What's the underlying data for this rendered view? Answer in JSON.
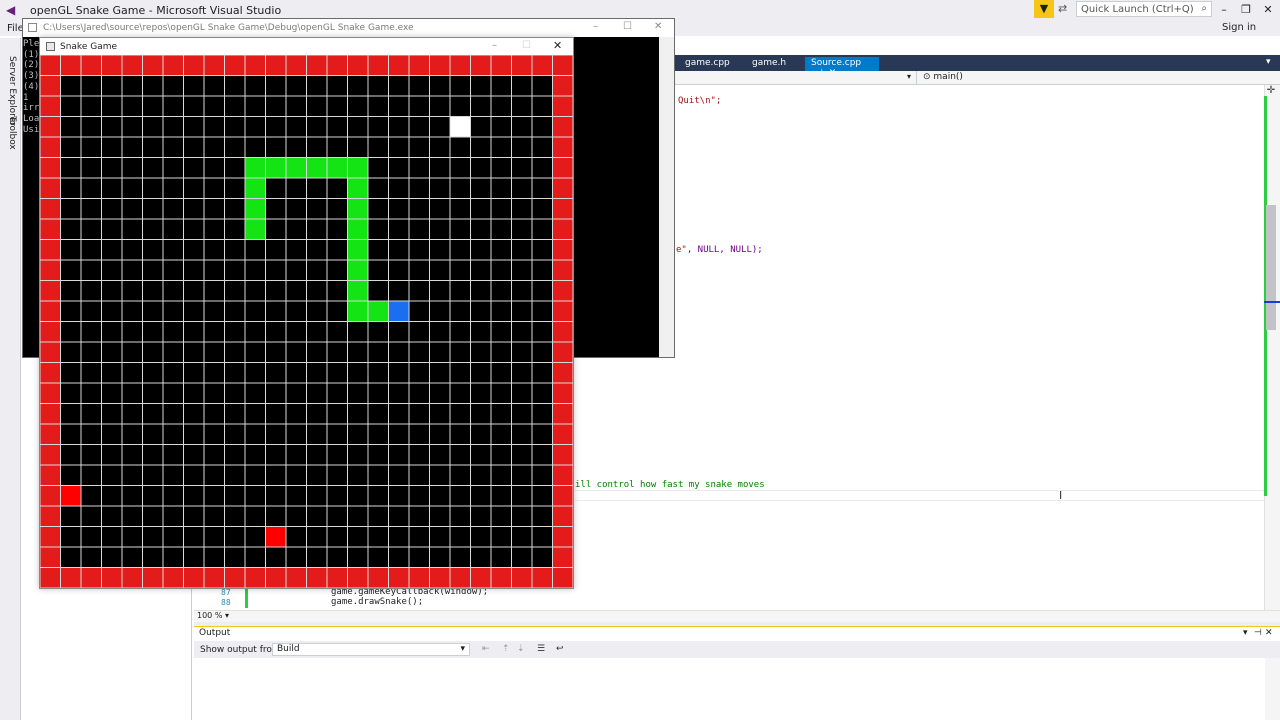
{
  "vs": {
    "title": "openGL Snake Game - Microsoft Visual Studio",
    "menu_file": "File",
    "quick_launch_placeholder": "Quick Launch (Ctrl+Q)",
    "sign_in": "Sign in",
    "side_tabs": [
      "Server Explorer",
      "Toolbox"
    ]
  },
  "console": {
    "title": "C:\\Users\\Jared\\source\\repos\\openGL Snake Game\\Debug\\openGL Snake Game.exe",
    "lines": [
      "Ple",
      "(1)",
      "(2)",
      "(3)",
      "(4)",
      "1",
      "irr",
      "Loa",
      "Usi"
    ]
  },
  "editor": {
    "tabs": [
      "game.cpp",
      "game.h",
      "Source.cpp"
    ],
    "active_tab": "Source.cpp",
    "scope": "main()",
    "code_fragment_1": "Quit\\n\";",
    "code_fragment_2_str": "e\"",
    "code_fragment_2_rest": ", NULL, NULL);",
    "comment_fragment": "ill control how fast my snake moves",
    "line_87": "87",
    "line_88": "88",
    "code_87": "game.gameKeyCallback(window);",
    "code_88": "game.drawSnake();",
    "zoom": "100 %"
  },
  "output": {
    "title": "Output",
    "show_from_label": "Show output from:",
    "show_from_value": "Build"
  },
  "snake_window": {
    "title": "Snake Game",
    "grid_size": 26,
    "colors": {
      "grid_line": "#d8d8d8",
      "border": "#e31b1b",
      "snake": "#14e414",
      "head": "#1a6ff0",
      "food_white": "#ffffff",
      "food_red": "#ff0000"
    },
    "snake_cells": [
      [
        10,
        6
      ],
      [
        10,
        7
      ],
      [
        10,
        8
      ],
      [
        10,
        5
      ],
      [
        11,
        5
      ],
      [
        12,
        5
      ],
      [
        13,
        5
      ],
      [
        14,
        5
      ],
      [
        15,
        5
      ],
      [
        15,
        6
      ],
      [
        15,
        7
      ],
      [
        15,
        8
      ],
      [
        15,
        9
      ],
      [
        15,
        10
      ],
      [
        15,
        11
      ],
      [
        15,
        12
      ],
      [
        16,
        12
      ],
      [
        17,
        12
      ]
    ],
    "head_cell": [
      17,
      12
    ],
    "white_food": [
      20,
      3
    ],
    "red_cells": [
      [
        1,
        21
      ],
      [
        11,
        23
      ]
    ]
  }
}
